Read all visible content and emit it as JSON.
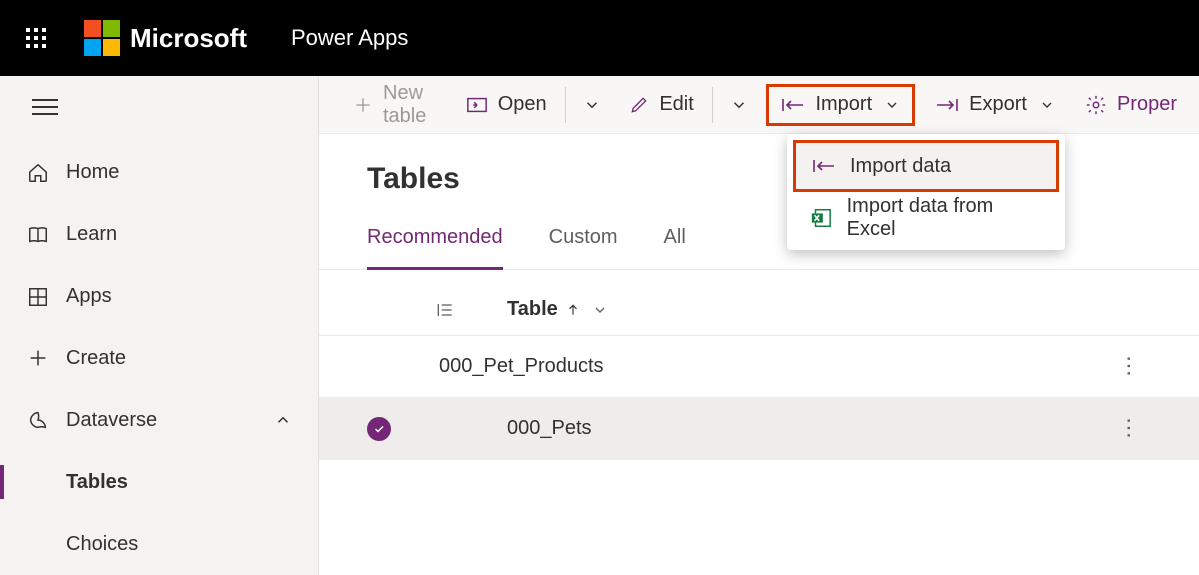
{
  "header": {
    "brand": "Microsoft",
    "product": "Power Apps"
  },
  "sidebar": {
    "items": [
      {
        "label": "Home"
      },
      {
        "label": "Learn"
      },
      {
        "label": "Apps"
      },
      {
        "label": "Create"
      },
      {
        "label": "Dataverse"
      },
      {
        "label": "Tables"
      },
      {
        "label": "Choices"
      }
    ]
  },
  "toolbar": {
    "new_table": "New table",
    "open": "Open",
    "edit": "Edit",
    "import": "Import",
    "export": "Export",
    "properties": "Proper"
  },
  "dropdown": {
    "import_data": "Import data",
    "import_excel": "Import data from Excel"
  },
  "page": {
    "title": "Tables",
    "tabs": [
      {
        "label": "Recommended"
      },
      {
        "label": "Custom"
      },
      {
        "label": "All"
      }
    ],
    "columns": {
      "table": "Table"
    },
    "rows": [
      {
        "name": "000_Pet_Products"
      },
      {
        "name": "000_Pets"
      }
    ]
  }
}
